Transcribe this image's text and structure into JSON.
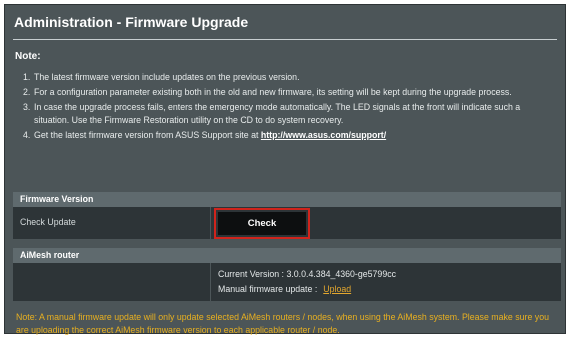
{
  "header": {
    "title": "Administration - Firmware Upgrade"
  },
  "note": {
    "heading": "Note:",
    "items": [
      {
        "number": "1.",
        "text": "The latest firmware version include updates on the previous version."
      },
      {
        "number": "2.",
        "text": "For a configuration parameter existing both in the old and new firmware, its setting will be kept during the upgrade process."
      },
      {
        "number": "3.",
        "text": "In case the upgrade process fails, enters the emergency mode automatically. The LED signals at the front will indicate such a situation. Use the Firmware Restoration utility on the CD to do system recovery."
      },
      {
        "number": "4.",
        "text": "Get the latest firmware version from ASUS Support site at ",
        "link": "http://www.asus.com/support/"
      }
    ]
  },
  "firmware_version": {
    "heading": "Firmware Version",
    "check_update_label": "Check Update",
    "check_button": "Check"
  },
  "aimesh": {
    "heading": "AiMesh router",
    "current_version": "Current Version : 3.0.0.4.384_4360-ge5799cc",
    "manual_update_label": "Manual firmware update :",
    "upload_link": "Upload"
  },
  "warning": "Note: A manual firmware update will only update selected AiMesh routers / nodes, when using the AiMesh system. Please make sure you are uploading the correct AiMesh firmware version to each applicable router / node.",
  "colors": {
    "panel_bg": "#4c5558",
    "row_bg": "#2d3437",
    "highlight_border": "#d0241c",
    "warning_text": "#e8b020",
    "upload_link": "#e3a72f"
  }
}
